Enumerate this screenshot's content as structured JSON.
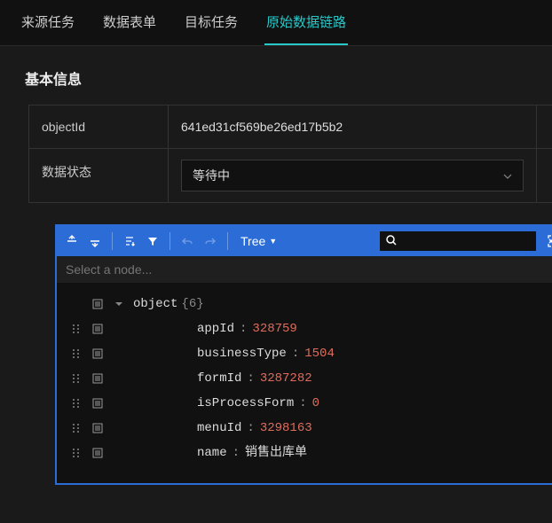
{
  "tabs": {
    "items": [
      {
        "label": "来源任务"
      },
      {
        "label": "数据表单"
      },
      {
        "label": "目标任务"
      },
      {
        "label": "原始数据链路"
      }
    ],
    "activeIndex": 3
  },
  "panel": {
    "title": "基本信息",
    "rows": {
      "objectId": {
        "label": "objectId",
        "value": "641ed31cf569be26ed17b5b2"
      },
      "status": {
        "label": "数据状态",
        "value": "等待中"
      }
    }
  },
  "viewer": {
    "mode": "Tree",
    "pathPlaceholder": "Select a node...",
    "root": {
      "label": "object",
      "count": "{6}",
      "children": [
        {
          "key": "appId",
          "value": "328759",
          "type": "num"
        },
        {
          "key": "businessType",
          "value": "1504",
          "type": "num"
        },
        {
          "key": "formId",
          "value": "3287282",
          "type": "num"
        },
        {
          "key": "isProcessForm",
          "value": "0",
          "type": "num"
        },
        {
          "key": "menuId",
          "value": "3298163",
          "type": "num"
        },
        {
          "key": "name",
          "value": "销售出库单",
          "type": "str"
        }
      ]
    }
  }
}
